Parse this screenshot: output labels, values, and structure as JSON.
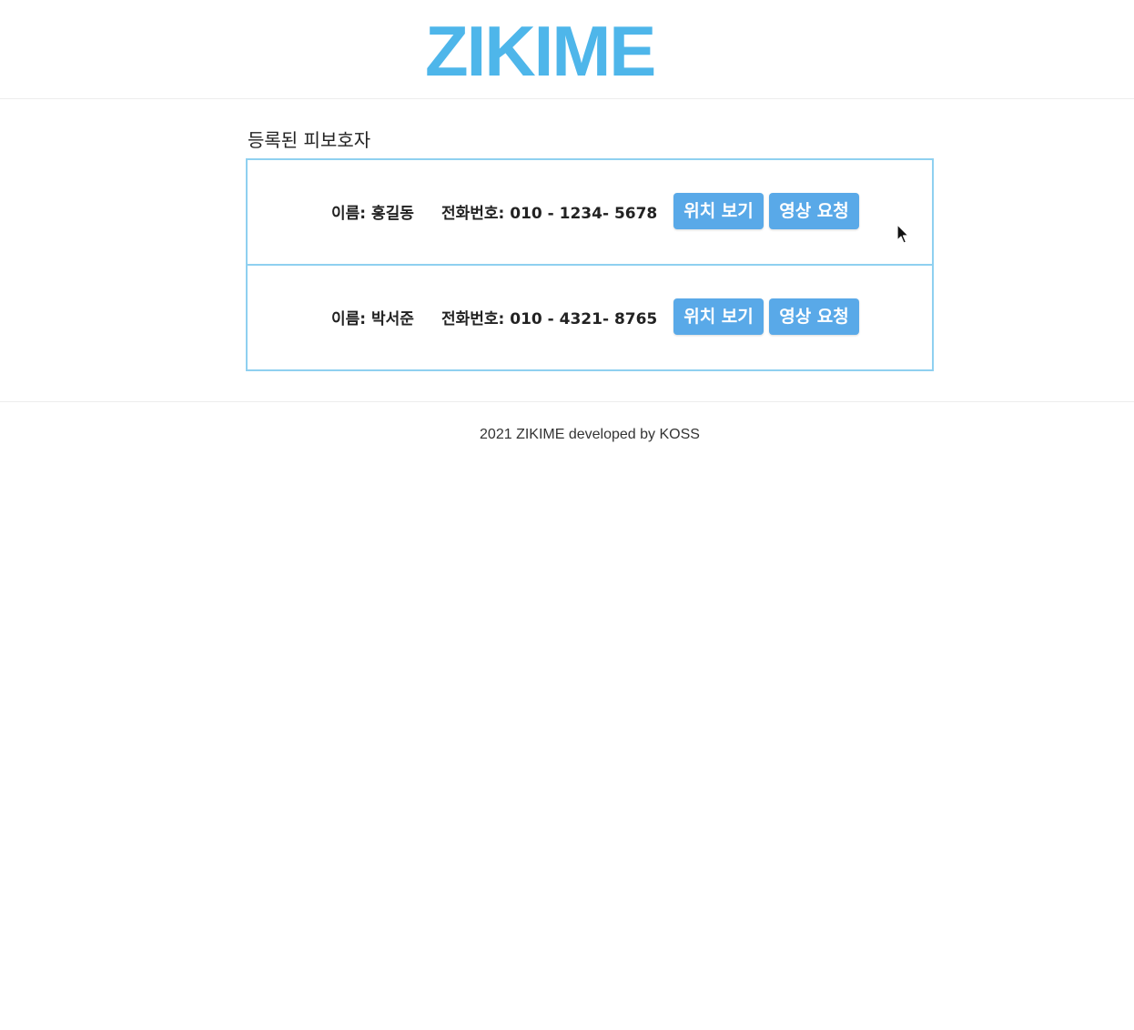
{
  "header": {
    "logo_text": "ZIKIME",
    "logo_color": "#4eb6ea"
  },
  "main": {
    "section_title": "등록된 피보호자",
    "wards": [
      {
        "name_text": "이름: 홍길동",
        "phone_text": "전화번호: 010 - 1234- 5678",
        "location_button_label": "위치 보기",
        "video_button_label": "영상 요청"
      },
      {
        "name_text": "이름: 박서준",
        "phone_text": "전화번호: 010 - 4321- 8765",
        "location_button_label": "위치 보기",
        "video_button_label": "영상 요청"
      }
    ],
    "card_border_color": "#8fd0f0",
    "button_color": "#59a9e8"
  },
  "footer": {
    "text": "2021 ZIKIME developed by KOSS"
  },
  "cursor": {
    "icon": "mouse-pointer-icon"
  }
}
